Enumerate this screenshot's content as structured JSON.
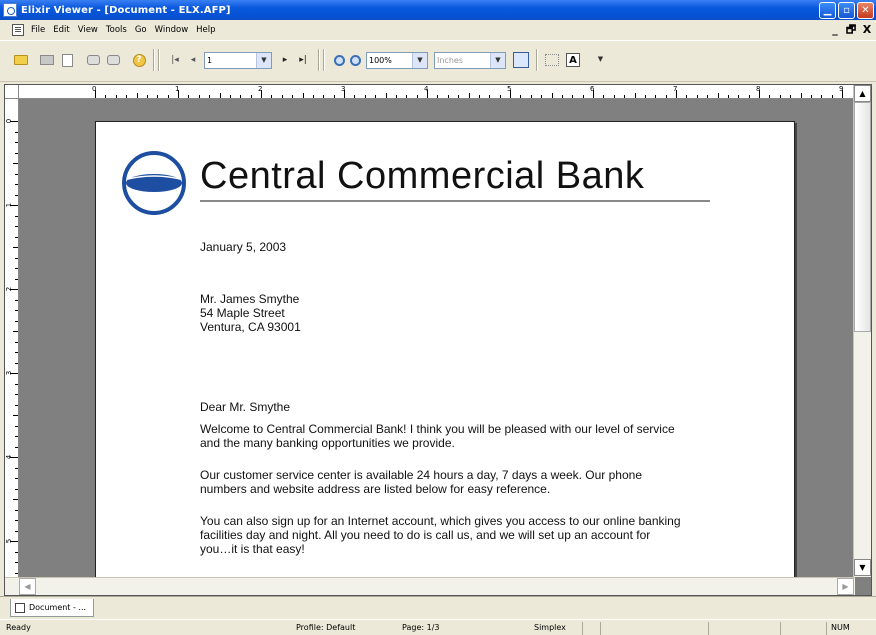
{
  "window": {
    "title": "Elixir Viewer - [Document - ELX.AFP]",
    "controls": [
      "minimize",
      "maximize",
      "close"
    ]
  },
  "menubar": {
    "items": [
      "File",
      "Edit",
      "View",
      "Tools",
      "Go",
      "Window",
      "Help"
    ],
    "mdi_controls": [
      "_",
      "🗗",
      "X"
    ]
  },
  "toolbar": {
    "page_value": "1",
    "zoom_value": "100%",
    "units_value": "Inches"
  },
  "ruler": {
    "horizontal_numbers": [
      "0",
      "1",
      "2",
      "3",
      "4",
      "5",
      "6",
      "7",
      "8",
      "9"
    ],
    "vertical_numbers": [
      "0",
      "1",
      "2",
      "3",
      "4",
      "5"
    ]
  },
  "document": {
    "bank_name": "Central Commercial Bank",
    "date": "January 5, 2003",
    "address_lines": [
      "Mr. James Smythe",
      "54 Maple Street",
      "Ventura, CA 93001"
    ],
    "salutation": "Dear Mr. Smythe",
    "paragraphs": [
      [
        "Welcome to Central Commercial Bank!  I think you will be pleased with our level of service",
        "and the many banking opportunities we provide."
      ],
      [
        "Our customer service center is available 24 hours a day, 7 days a week.  Our phone",
        "numbers and website address are listed below for easy reference."
      ],
      [
        "You can also sign up for an Internet account, which gives you access to our online banking",
        "facilities day and night.  All you need to do is call us, and we will set up an account for",
        "you…it is that easy!"
      ]
    ]
  },
  "tabs": {
    "document_tab": "Document - ..."
  },
  "status": {
    "ready": "Ready",
    "profile": "Profile: Default",
    "page": "Page: 1/3",
    "duplex": "Simplex",
    "num": "NUM"
  },
  "colors": {
    "titlebar_blue": "#0553d6",
    "logo_blue": "#1e4ea1",
    "workspace_gray": "#808080"
  }
}
